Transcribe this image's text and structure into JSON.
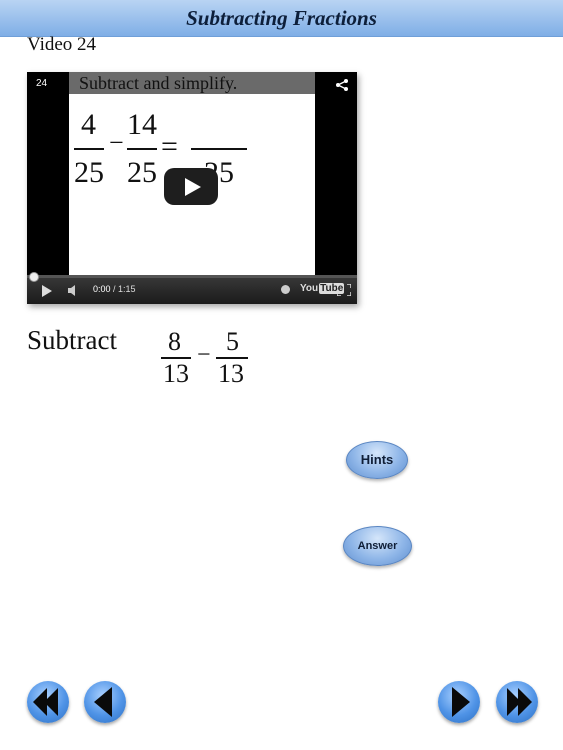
{
  "header": {
    "title": "Subtracting Fractions"
  },
  "video": {
    "label": "Video 24",
    "number": "24",
    "slide_heading": "Subtract and simplify.",
    "equation": {
      "n1": "4",
      "d1": "25",
      "n2": "14",
      "d2": "25",
      "eq": "=",
      "minus": "−",
      "d3": "25"
    },
    "time_current": "0:00",
    "time_separator": " / ",
    "time_total": "1:15",
    "brand_you": "You",
    "brand_tube": "Tube",
    "progress": 0
  },
  "problem": {
    "label": "Subtract",
    "frac1": {
      "num": "8",
      "den": "13"
    },
    "operator": "−",
    "frac2": {
      "num": "5",
      "den": "13"
    }
  },
  "buttons": {
    "hints": "Hints",
    "answer": "Answer"
  },
  "nav": {
    "first_icon": "double-left-arrow-icon",
    "prev_icon": "left-arrow-icon",
    "next_icon": "right-arrow-icon",
    "last_icon": "double-right-arrow-icon"
  },
  "colors": {
    "header": "#8fb8ea",
    "button": "#8fb6e8",
    "nav": "#4f93e6"
  }
}
